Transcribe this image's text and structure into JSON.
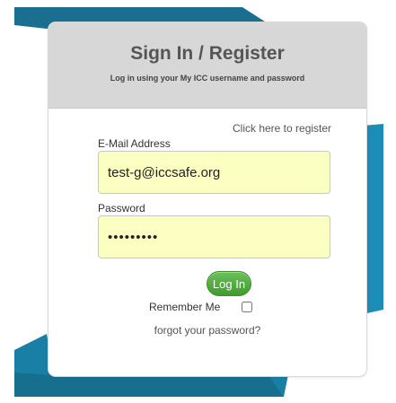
{
  "header": {
    "title": "Sign In / Register",
    "subtitle": "Log in using your My ICC username and password"
  },
  "form": {
    "register_link": "Click here to register",
    "email_label": "E-Mail Address",
    "email_value": "test-g@iccsafe.org",
    "password_label": "Password",
    "password_value": "•••••••••",
    "login_label": "Log In",
    "remember_label": "Remember Me",
    "remember_checked": false,
    "forgot_link": "forgot your password?"
  },
  "colors": {
    "background_accent": "#1b8db6",
    "input_background": "#fbffc2",
    "button_green": "#4aa83a",
    "header_gray": "#d7d7d7"
  }
}
